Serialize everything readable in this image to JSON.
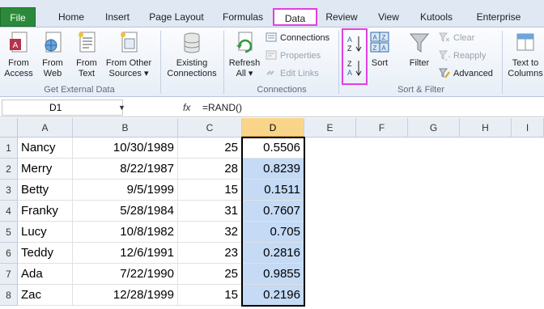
{
  "tabs": [
    "File",
    "Home",
    "Insert",
    "Page Layout",
    "Formulas",
    "Data",
    "Review",
    "View",
    "Kutools",
    "Enterprise"
  ],
  "ribbon": {
    "from_access": [
      "From",
      "Access"
    ],
    "from_web": [
      "From",
      "Web"
    ],
    "from_text": [
      "From",
      "Text"
    ],
    "from_other": [
      "From Other",
      "Sources ▾"
    ],
    "existing": [
      "Existing",
      "Connections"
    ],
    "get_external_label": "Get External Data",
    "refresh": [
      "Refresh",
      "All ▾"
    ],
    "connections": "Connections",
    "properties": "Properties",
    "edit_links": "Edit Links",
    "connections_label": "Connections",
    "sort": "Sort",
    "filter": "Filter",
    "clear": "Clear",
    "reapply": "Reapply",
    "advanced": "Advanced",
    "sort_filter_label": "Sort & Filter",
    "text_to_columns": [
      "Text to",
      "Columns"
    ]
  },
  "formula_bar": {
    "name_box": "D1",
    "fx": "fx",
    "formula": "=RAND()"
  },
  "columns": [
    "A",
    "B",
    "C",
    "D",
    "E",
    "F",
    "G",
    "H",
    "I"
  ],
  "rows": [
    {
      "num": "1",
      "a": "Nancy",
      "b": "10/30/1989",
      "c": "25",
      "d": "0.5506"
    },
    {
      "num": "2",
      "a": "Merry",
      "b": "8/22/1987",
      "c": "28",
      "d": "0.8239"
    },
    {
      "num": "3",
      "a": "Betty",
      "b": "9/5/1999",
      "c": "15",
      "d": "0.1511"
    },
    {
      "num": "4",
      "a": "Franky",
      "b": "5/28/1984",
      "c": "31",
      "d": "0.7607"
    },
    {
      "num": "5",
      "a": "Lucy",
      "b": "10/8/1982",
      "c": "32",
      "d": "0.705"
    },
    {
      "num": "6",
      "a": "Teddy",
      "b": "12/6/1991",
      "c": "23",
      "d": "0.2816"
    },
    {
      "num": "7",
      "a": "Ada",
      "b": "7/22/1990",
      "c": "25",
      "d": "0.9855"
    },
    {
      "num": "8",
      "a": "Zac",
      "b": "12/28/1999",
      "c": "15",
      "d": "0.2196"
    }
  ],
  "colors": {
    "highlight": "#e040e0",
    "file_tab": "#2a8a3a",
    "selection": "#c4daf5"
  }
}
